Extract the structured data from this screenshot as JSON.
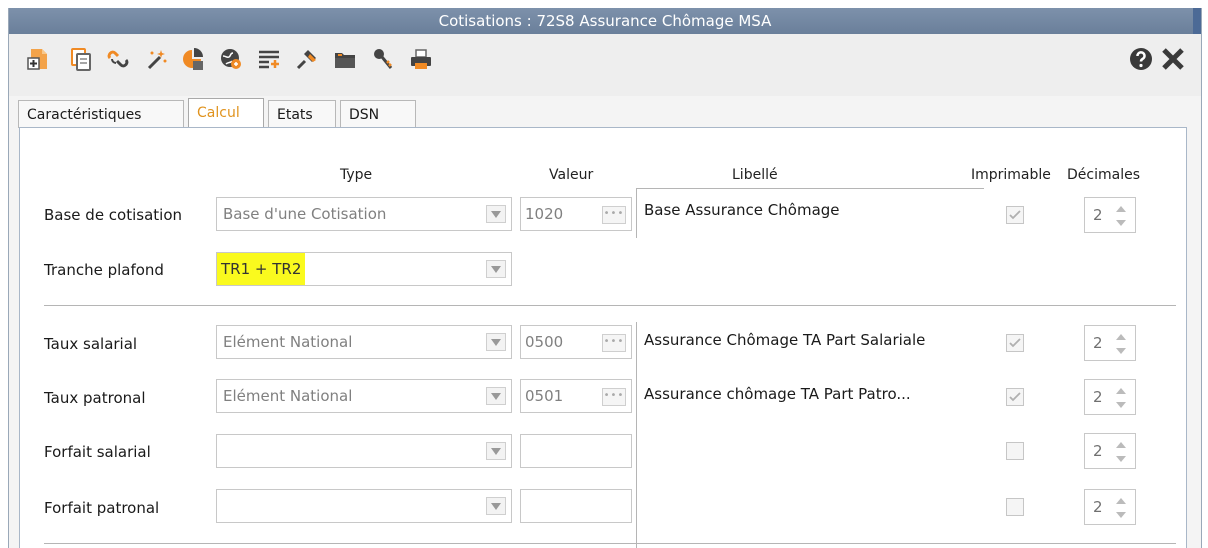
{
  "window": {
    "title": "Cotisations : 72S8 Assurance Chômage MSA"
  },
  "toolbar": {
    "icons": [
      "new-document-icon",
      "copy-document-icon",
      "link-icon",
      "magic-wand-icon",
      "chart-icon",
      "globe-icon",
      "list-add-icon",
      "pin-icon",
      "folder-icon",
      "key-icon",
      "print-icon"
    ],
    "help_icon": "help-icon",
    "close_icon": "close-icon"
  },
  "tabs": [
    {
      "label": "Caractéristiques",
      "active": false
    },
    {
      "label": "Calcul",
      "active": true
    },
    {
      "label": "Etats",
      "active": false
    },
    {
      "label": "DSN",
      "active": false
    }
  ],
  "headers": {
    "type": "Type",
    "valeur": "Valeur",
    "libelle": "Libellé",
    "imprimable": "Imprimable",
    "decimales": "Décimales"
  },
  "rows": {
    "base": {
      "label": "Base de cotisation",
      "type": "Base d'une Cotisation",
      "valeur": "1020",
      "libelle": "Base Assurance Chômage",
      "imprimable": true,
      "decimales": "2"
    },
    "tranche": {
      "label": "Tranche plafond",
      "type": "TR1 + TR2"
    },
    "taux_salarial": {
      "label": "Taux salarial",
      "type": "Elément National",
      "valeur": "0500",
      "libelle": "Assurance Chômage TA Part Salariale",
      "imprimable": true,
      "decimales": "2"
    },
    "taux_patronal": {
      "label": "Taux patronal",
      "type": "Elément National",
      "valeur": "0501",
      "libelle": "Assurance chômage TA Part Patro...",
      "imprimable": true,
      "decimales": "2"
    },
    "forfait_salarial": {
      "label": "Forfait salarial",
      "type": "",
      "valeur": "",
      "libelle": "",
      "imprimable": false,
      "decimales": "2"
    },
    "forfait_patronal": {
      "label": "Forfait  patronal",
      "type": "",
      "valeur": "",
      "libelle": "",
      "imprimable": false,
      "decimales": "2"
    }
  },
  "colors": {
    "titlebar": "#6f839e",
    "active_tab": "#e0931e",
    "highlight": "#fafa1e",
    "icon_orange": "#f08a24",
    "icon_dark": "#444444"
  }
}
